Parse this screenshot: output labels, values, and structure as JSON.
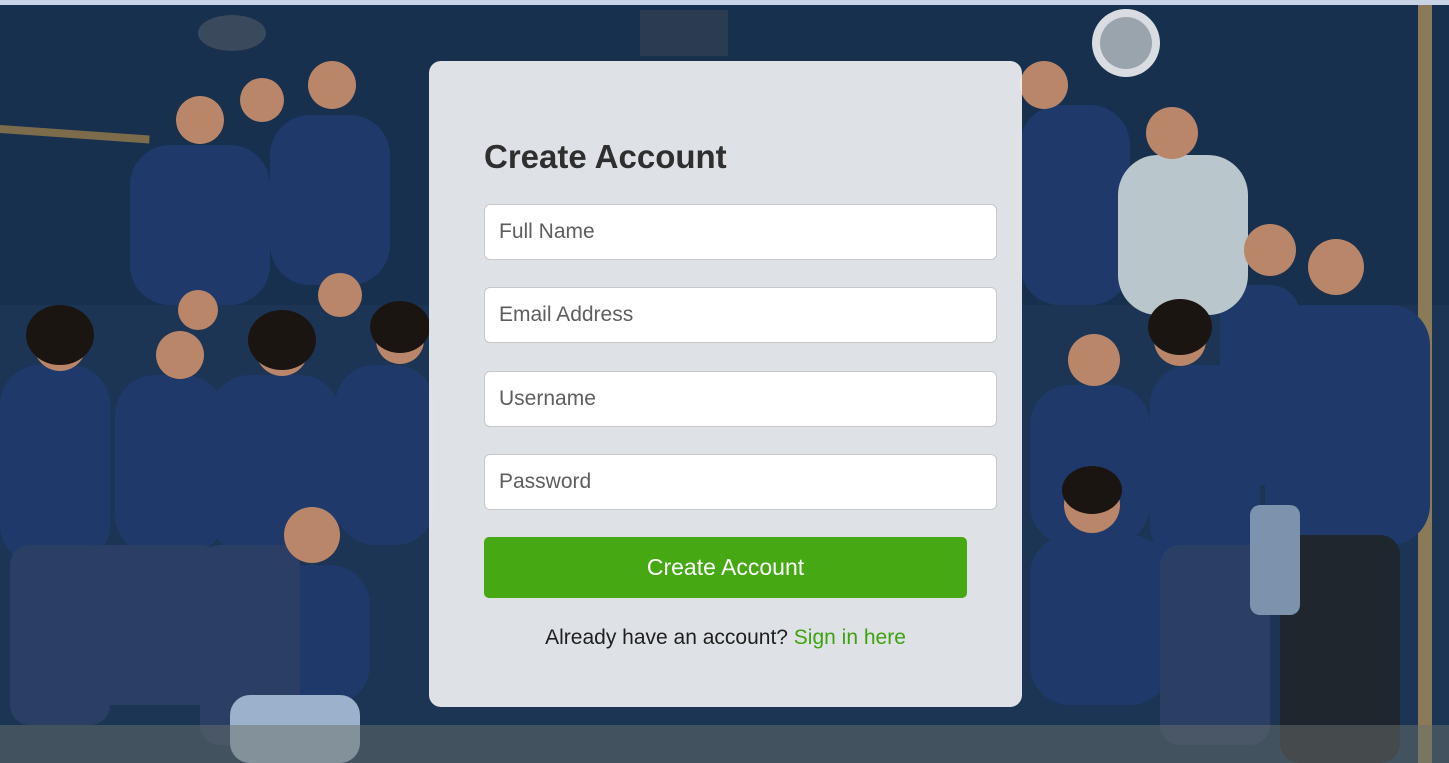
{
  "backdrop": {
    "description_icon": "team-photo-background"
  },
  "form": {
    "title": "Create Account",
    "fields": {
      "full_name_placeholder": "Full Name",
      "email_placeholder": "Email Address",
      "username_placeholder": "Username",
      "password_placeholder": "Password"
    },
    "submit_label": "Create Account",
    "footer_text": "Already have an account?",
    "signin_link": "Sign in here"
  },
  "colors": {
    "accent": "#46a913",
    "link": "#3ea20f",
    "card": "#f4f5f7"
  }
}
